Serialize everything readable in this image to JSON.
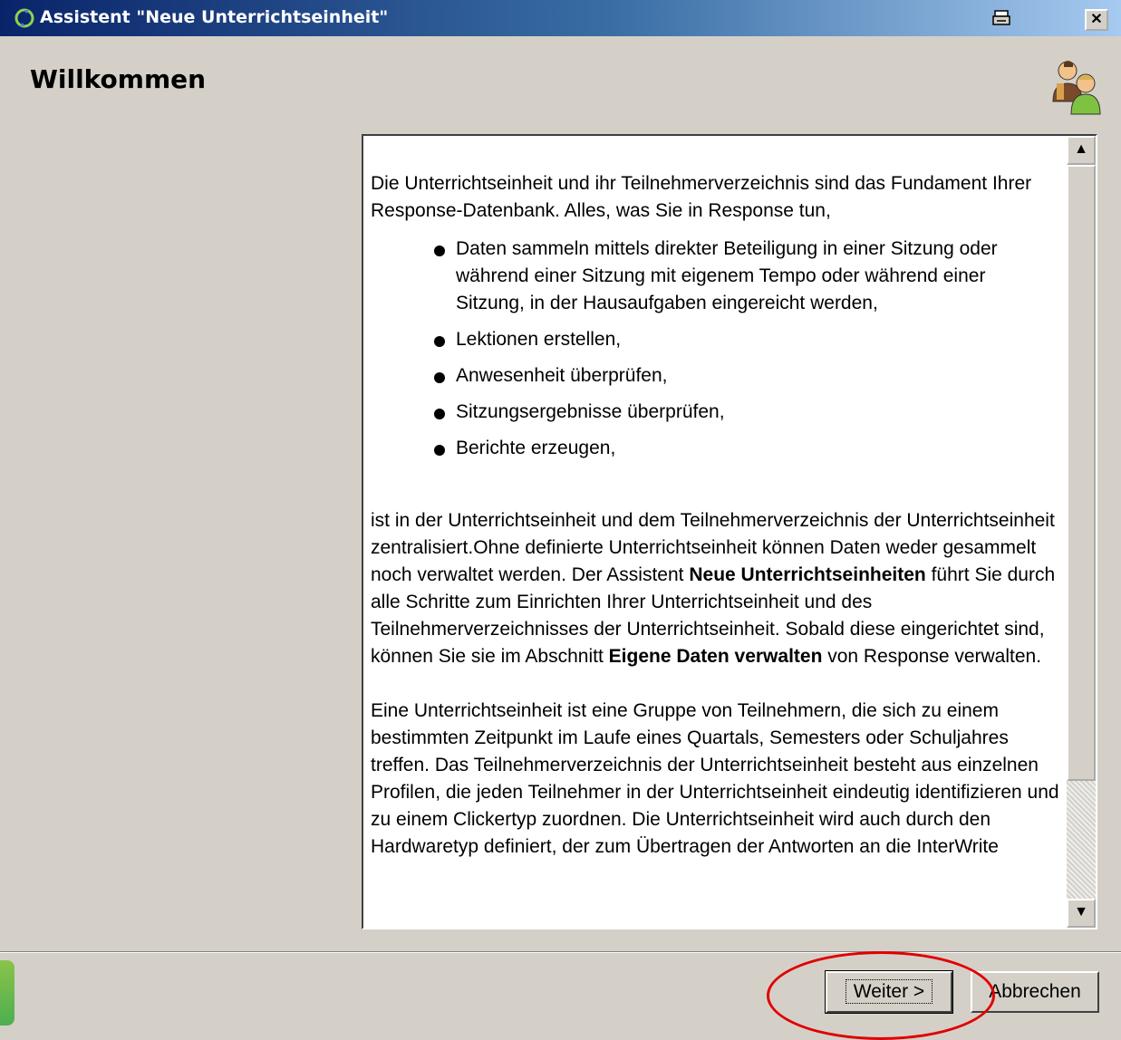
{
  "window": {
    "title": "Assistent \"Neue Unterrichtseinheit\"",
    "print_icon": "printer-icon",
    "close_label": "✕"
  },
  "header": {
    "title": "Willkommen",
    "icon": "users-icon"
  },
  "content": {
    "intro": "Die Unterrichtseinheit und ihr Teilnehmerverzeichnis sind das Fundament Ihrer Response-Datenbank. Alles, was Sie in Response tun,",
    "bullets": [
      "Daten sammeln mittels direkter Beteiligung in einer Sitzung oder während einer Sitzung mit eigenem Tempo oder während einer Sitzung, in der Hausaufgaben eingereicht werden,",
      "Lektionen erstellen,",
      "Anwesenheit überprüfen,",
      "Sitzungsergebnisse überprüfen,",
      "Berichte erzeugen,"
    ],
    "para2_a": "ist in der Unterrichtseinheit und dem Teilnehmerverzeichnis der Unterrichtseinheit zentralisiert.Ohne definierte Unterrichtseinheit können Daten weder gesammelt noch verwaltet werden. Der Assistent ",
    "para2_bold1": "Neue Unterrichtseinheiten",
    "para2_b": " führt Sie durch alle Schritte zum Einrichten Ihrer Unterrichtseinheit und des Teilnehmerverzeichnisses der Unterrichtseinheit. Sobald diese eingerichtet sind, können Sie sie im Abschnitt ",
    "para2_bold2": "Eigene Daten verwalten",
    "para2_c": " von Response verwalten.",
    "para3": "Eine Unterrichtseinheit ist eine Gruppe von Teilnehmern, die sich zu einem bestimmten Zeitpunkt im Laufe eines Quartals, Semesters oder Schuljahres treffen. Das Teilnehmerverzeichnis der Unterrichtseinheit besteht aus einzelnen Profilen, die jeden Teilnehmer in der Unterrichtseinheit eindeutig identifizieren und zu einem Clickertyp zuordnen. Die Unterrichtseinheit wird auch durch den Hardwaretyp definiert, der zum Übertragen der Antworten an die InterWrite"
  },
  "scrollbar": {
    "up_arrow": "▲",
    "down_arrow": "▼"
  },
  "buttons": {
    "next": "Weiter >",
    "cancel": "Abbrechen"
  },
  "colors": {
    "title_gradient_start": "#0a246a",
    "highlight": "#e00000",
    "window_bg": "#d4d0c8"
  }
}
